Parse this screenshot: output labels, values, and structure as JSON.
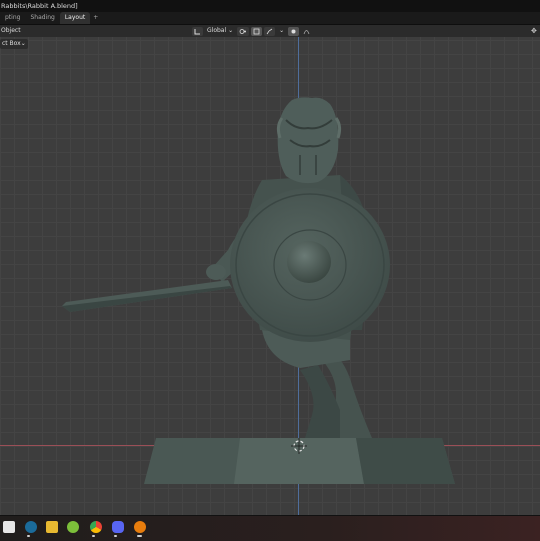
{
  "window": {
    "title": "Rabbits\\Rabbit A.blend]"
  },
  "workspace_tabs": [
    {
      "label": "pting",
      "active": false
    },
    {
      "label": "Shading",
      "active": false
    },
    {
      "label": "Layout",
      "active": true
    }
  ],
  "workspace_add": "+",
  "header": {
    "mode_label": "Object",
    "transform_orientation": "Global",
    "transform_dropdown_glyph": "⌄",
    "snap_dropdown_glyph": "⌄"
  },
  "subheader": {
    "select_mode": "ct Box",
    "select_dropdown_glyph": "⌄"
  },
  "taskbar": {
    "apps": [
      {
        "name": "windows-icon",
        "color": "#e6e6e6"
      },
      {
        "name": "steam-icon",
        "color": "#1b6b9a"
      },
      {
        "name": "file-explorer-icon",
        "color": "#e8b931"
      },
      {
        "name": "green-app-icon",
        "color": "#7cbf3a"
      },
      {
        "name": "chrome-icon",
        "color": "#e94235"
      },
      {
        "name": "discord-icon",
        "color": "#5865f2"
      },
      {
        "name": "blender-icon",
        "color": "#e87d0d"
      }
    ]
  },
  "colors": {
    "model": "#4d5b57",
    "model_shade": "#3a4643",
    "viewport_bg": "#3d3d3d"
  }
}
